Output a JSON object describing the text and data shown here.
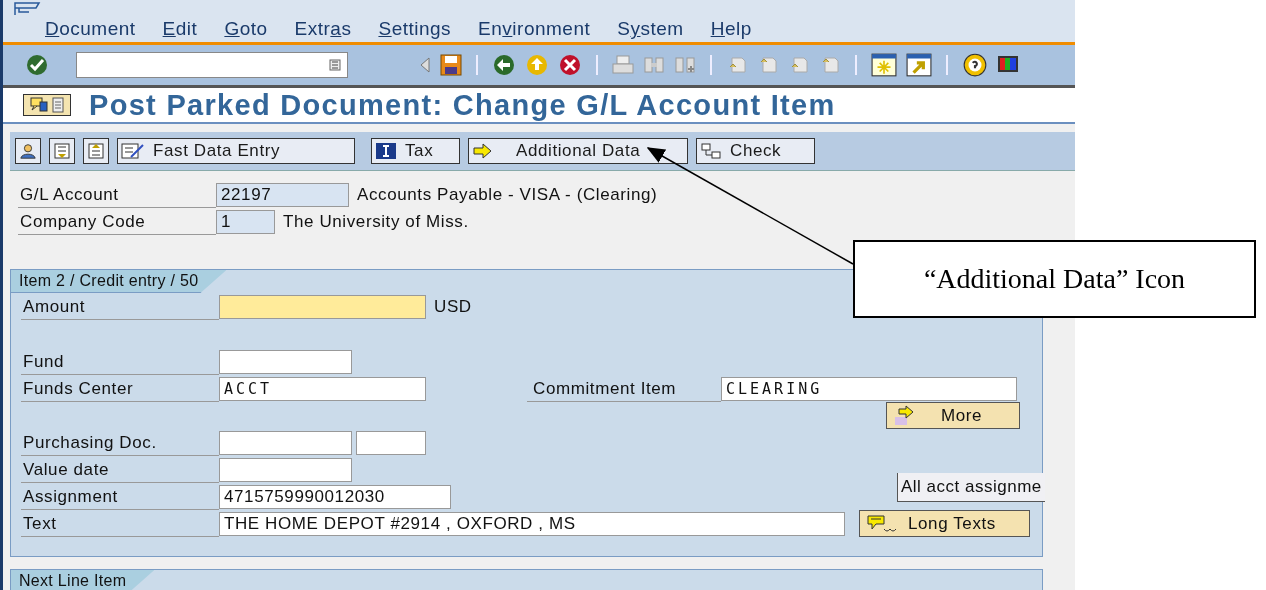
{
  "menu": [
    {
      "key": "D",
      "post": "ocument"
    },
    {
      "key": "E",
      "post": "dit"
    },
    {
      "key": "G",
      "post": "oto"
    },
    {
      "pre": "Extr",
      "key": "a",
      "post": "s"
    },
    {
      "key": "S",
      "post": "ettings"
    },
    {
      "pre": "En",
      "key": "v",
      "post": "ironment"
    },
    {
      "pre": "S",
      "key": "y",
      "post": "stem"
    },
    {
      "key": "H",
      "post": "elp"
    }
  ],
  "title": "Post Parked Document: Change G/L Account Item",
  "app_toolbar": [
    {
      "kind": "icon"
    },
    {
      "kind": "icon"
    },
    {
      "kind": "icon"
    },
    {
      "kind": "text",
      "label": "Fast Data Entry"
    },
    {
      "kind": "text",
      "label": "Tax"
    },
    {
      "kind": "text",
      "label": "Additional Data"
    },
    {
      "kind": "text",
      "label": "Check"
    }
  ],
  "header": [
    {
      "label": "G/L Account",
      "value": "22197",
      "kind": "display",
      "description": "Accounts Payable - VISA - (Clearing)"
    },
    {
      "label": "Company Code",
      "value": "1",
      "kind": "display",
      "description": "The University of Miss."
    }
  ],
  "item_panel": {
    "title": "Item 2 / Credit entry / 50",
    "amount": {
      "label": "Amount",
      "kind": "required",
      "currency": "USD"
    },
    "fund": {
      "label": "Fund",
      "kind": "editable"
    },
    "funds_center": {
      "label": "Funds Center",
      "value": "ACCT",
      "kind": "editable"
    },
    "commitment_item": {
      "label": "Commitment Item",
      "value": "CLEARING",
      "kind": "editable"
    },
    "more_button": {
      "label": "More"
    },
    "purchasing_doc": {
      "label": "Purchasing Doc.",
      "kind": "editable"
    },
    "value_date": {
      "label": "Value date",
      "kind": "editable"
    },
    "assignment": {
      "label": "Assignment",
      "value": "4715759990012030",
      "kind": "editable"
    },
    "text": {
      "label": "Text",
      "value": "THE HOME DEPOT #2914 , OXFORD , MS",
      "kind": "editable"
    },
    "long_texts_button": {
      "label": "Long Texts"
    },
    "tooltip": "All acct assignme"
  },
  "next_panel": {
    "title": "Next Line Item"
  },
  "callout": {
    "text": "“Additional Data” Icon"
  }
}
